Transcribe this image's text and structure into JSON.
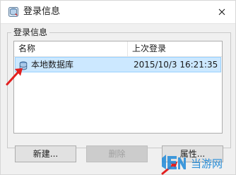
{
  "window": {
    "title": "登录信息",
    "icon": "database-app-icon"
  },
  "group": {
    "label": "登录信息"
  },
  "list": {
    "columns": [
      "名称",
      "上次登录"
    ],
    "rows": [
      {
        "name": "本地数据库",
        "last_login": "2015/10/3 16:21:35",
        "selected": true,
        "icon": "database-icon"
      }
    ]
  },
  "buttons": {
    "new": "新建...",
    "delete": "删除",
    "properties": "属性..."
  },
  "annotations": {
    "arrow_color": "#e21f1f"
  },
  "watermark": {
    "text": "当游网",
    "brand_color": "#2b8fd9"
  }
}
